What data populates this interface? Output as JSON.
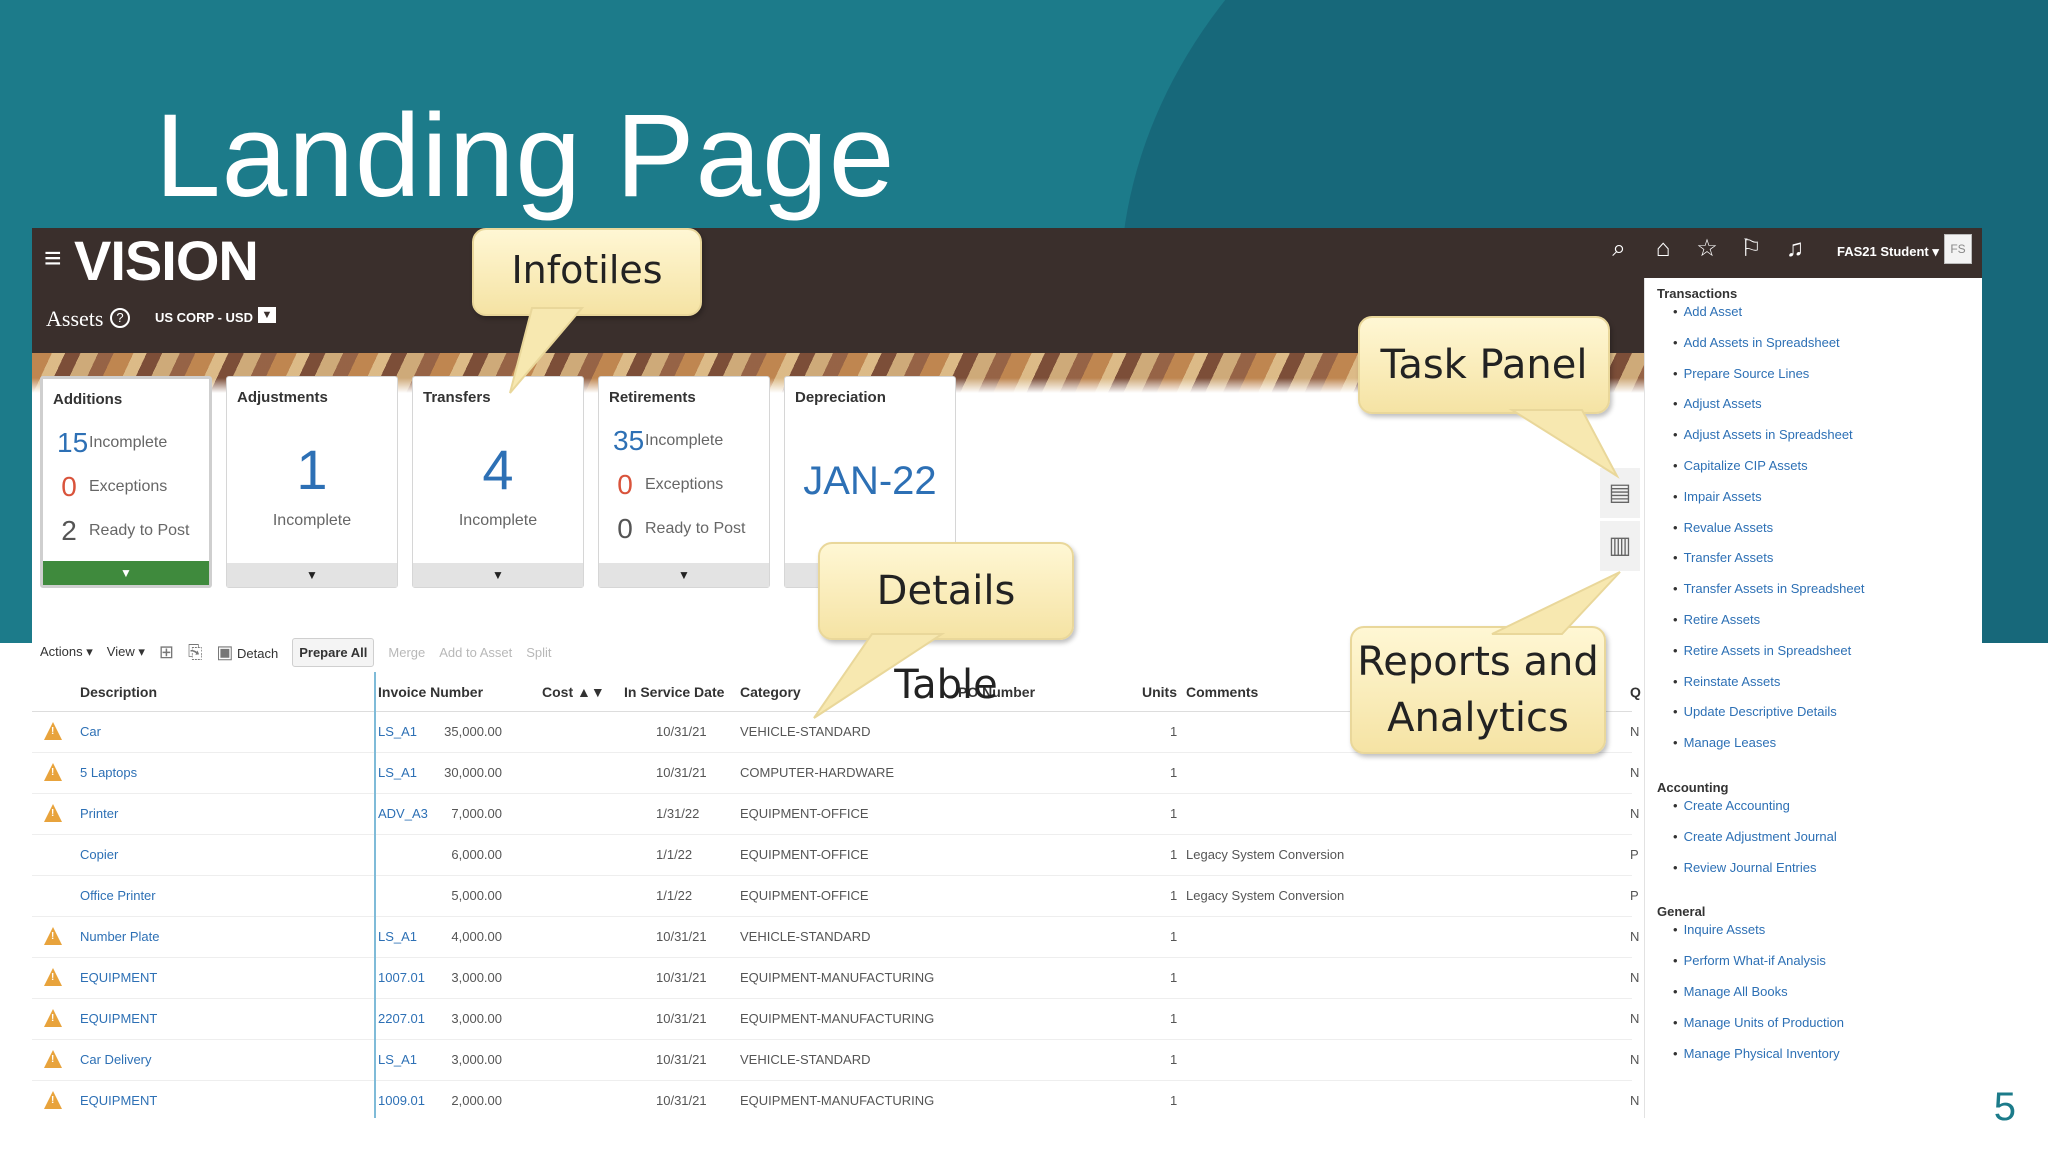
{
  "slide": {
    "title": "Landing Page",
    "number": "5"
  },
  "app": {
    "logo": "VISION",
    "page_name": "Assets",
    "ledger": "US CORP - USD",
    "user_name": "FAS21 Student",
    "user_initials": "FS",
    "icons": [
      "search-icon",
      "home-icon",
      "star-icon",
      "flag-icon",
      "bell-icon"
    ]
  },
  "callouts": {
    "infotiles": "Infotiles",
    "task_panel": "Task Panel",
    "details_table": "Details Table",
    "reports": "Reports and Analytics"
  },
  "tiles": [
    {
      "title": "Additions",
      "rows": [
        {
          "num": "15",
          "label": "Incomplete",
          "color": "#2d70b5"
        },
        {
          "num": "0",
          "label": "Exceptions",
          "color": "#d9533b"
        },
        {
          "num": "2",
          "label": "Ready to Post",
          "color": "#555555"
        }
      ]
    },
    {
      "title": "Adjustments",
      "big": "1",
      "big_label": "Incomplete"
    },
    {
      "title": "Transfers",
      "big": "4",
      "big_label": "Incomplete"
    },
    {
      "title": "Retirements",
      "rows": [
        {
          "num": "35",
          "label": "Incomplete",
          "color": "#2d70b5"
        },
        {
          "num": "0",
          "label": "Exceptions",
          "color": "#d9533b"
        },
        {
          "num": "0",
          "label": "Ready to Post",
          "color": "#555555"
        }
      ]
    },
    {
      "title": "Depreciation",
      "period": "JAN-22"
    }
  ],
  "toolbar": {
    "actions": "Actions ▾",
    "view": "View ▾",
    "detach": "Detach",
    "prepare_all": "Prepare All",
    "merge": "Merge",
    "add_to_asset": "Add to Asset",
    "split": "Split"
  },
  "table": {
    "headers": [
      "Description",
      "Invoice Number",
      "Cost ▲▼",
      "In Service Date",
      "Category",
      "PO Number",
      "Units",
      "Comments",
      "Q"
    ],
    "rows": [
      {
        "warn": true,
        "desc": "Car",
        "inv": "LS_A1",
        "cost": "35,000.00",
        "date": "10/31/21",
        "cat": "VEHICLE-STANDARD",
        "units": "1",
        "comments": "",
        "q": "N"
      },
      {
        "warn": true,
        "desc": "5 Laptops",
        "inv": "LS_A1",
        "cost": "30,000.00",
        "date": "10/31/21",
        "cat": "COMPUTER-HARDWARE",
        "units": "1",
        "comments": "",
        "q": "N"
      },
      {
        "warn": true,
        "desc": "Printer",
        "inv": "ADV_A3",
        "cost": "7,000.00",
        "date": "1/31/22",
        "cat": "EQUIPMENT-OFFICE",
        "units": "1",
        "comments": "",
        "q": "N"
      },
      {
        "warn": false,
        "desc": "Copier",
        "inv": "",
        "cost": "6,000.00",
        "date": "1/1/22",
        "cat": "EQUIPMENT-OFFICE",
        "units": "1",
        "comments": "Legacy System Conversion",
        "q": "P"
      },
      {
        "warn": false,
        "desc": "Office Printer",
        "inv": "",
        "cost": "5,000.00",
        "date": "1/1/22",
        "cat": "EQUIPMENT-OFFICE",
        "units": "1",
        "comments": "Legacy System Conversion",
        "q": "P"
      },
      {
        "warn": true,
        "desc": "Number Plate",
        "inv": "LS_A1",
        "cost": "4,000.00",
        "date": "10/31/21",
        "cat": "VEHICLE-STANDARD",
        "units": "1",
        "comments": "",
        "q": "N"
      },
      {
        "warn": true,
        "desc": "EQUIPMENT",
        "inv": "1007.01",
        "cost": "3,000.00",
        "date": "10/31/21",
        "cat": "EQUIPMENT-MANUFACTURING",
        "units": "1",
        "comments": "",
        "q": "N"
      },
      {
        "warn": true,
        "desc": "EQUIPMENT",
        "inv": "2207.01",
        "cost": "3,000.00",
        "date": "10/31/21",
        "cat": "EQUIPMENT-MANUFACTURING",
        "units": "1",
        "comments": "",
        "q": "N"
      },
      {
        "warn": true,
        "desc": "Car Delivery",
        "inv": "LS_A1",
        "cost": "3,000.00",
        "date": "10/31/21",
        "cat": "VEHICLE-STANDARD",
        "units": "1",
        "comments": "",
        "q": "N"
      },
      {
        "warn": true,
        "desc": "EQUIPMENT",
        "inv": "1009.01",
        "cost": "2,000.00",
        "date": "10/31/21",
        "cat": "EQUIPMENT-MANUFACTURING",
        "units": "1",
        "comments": "",
        "q": "N"
      }
    ]
  },
  "task_panel": {
    "sections": [
      {
        "title": "Transactions",
        "items": [
          "Add Asset",
          "Add Assets in Spreadsheet",
          "Prepare Source Lines",
          "Adjust Assets",
          "Adjust Assets in Spreadsheet",
          "Capitalize CIP Assets",
          "Impair Assets",
          "Revalue Assets",
          "Transfer Assets",
          "Transfer Assets in Spreadsheet",
          "Retire Assets",
          "Retire Assets in Spreadsheet",
          "Reinstate Assets",
          "Update Descriptive Details",
          "Manage Leases"
        ]
      },
      {
        "title": "Accounting",
        "items": [
          "Create Accounting",
          "Create Adjustment Journal",
          "Review Journal Entries"
        ]
      },
      {
        "title": "General",
        "items": [
          "Inquire Assets",
          "Perform What-if Analysis",
          "Manage All Books",
          "Manage Units of Production",
          "Manage Physical Inventory"
        ]
      }
    ]
  }
}
